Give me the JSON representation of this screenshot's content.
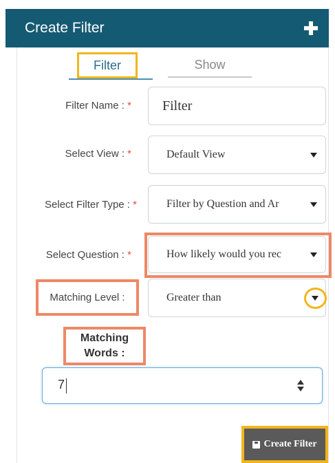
{
  "header": {
    "title": "Create Filter",
    "add_icon": "plus-icon"
  },
  "tabs": [
    {
      "label": "Filter",
      "active": true
    },
    {
      "label": "Show",
      "active": false
    }
  ],
  "required_marker": "*",
  "form": {
    "filter_name": {
      "label": "Filter Name :",
      "value": "Filter"
    },
    "select_view": {
      "label": "Select View :",
      "value": "Default View"
    },
    "filter_type": {
      "label": "Select Filter Type :",
      "value": "Filter by Question and Ar"
    },
    "question": {
      "label": "Select Question :",
      "value": "How likely would you rec"
    },
    "matching_level": {
      "label": "Matching Level :",
      "value": "Greater than"
    },
    "matching_words": {
      "label_line1": "Matching",
      "label_line2": "Words :",
      "value": "7"
    }
  },
  "actions": {
    "create_label": "Create Filter",
    "create_icon": "save-icon"
  },
  "colors": {
    "header_bg": "#155a73",
    "highlight_orange": "#ee8866",
    "highlight_yellow": "#f1b51c",
    "button_bg": "#5a5a5a",
    "required": "#e24b4b"
  }
}
